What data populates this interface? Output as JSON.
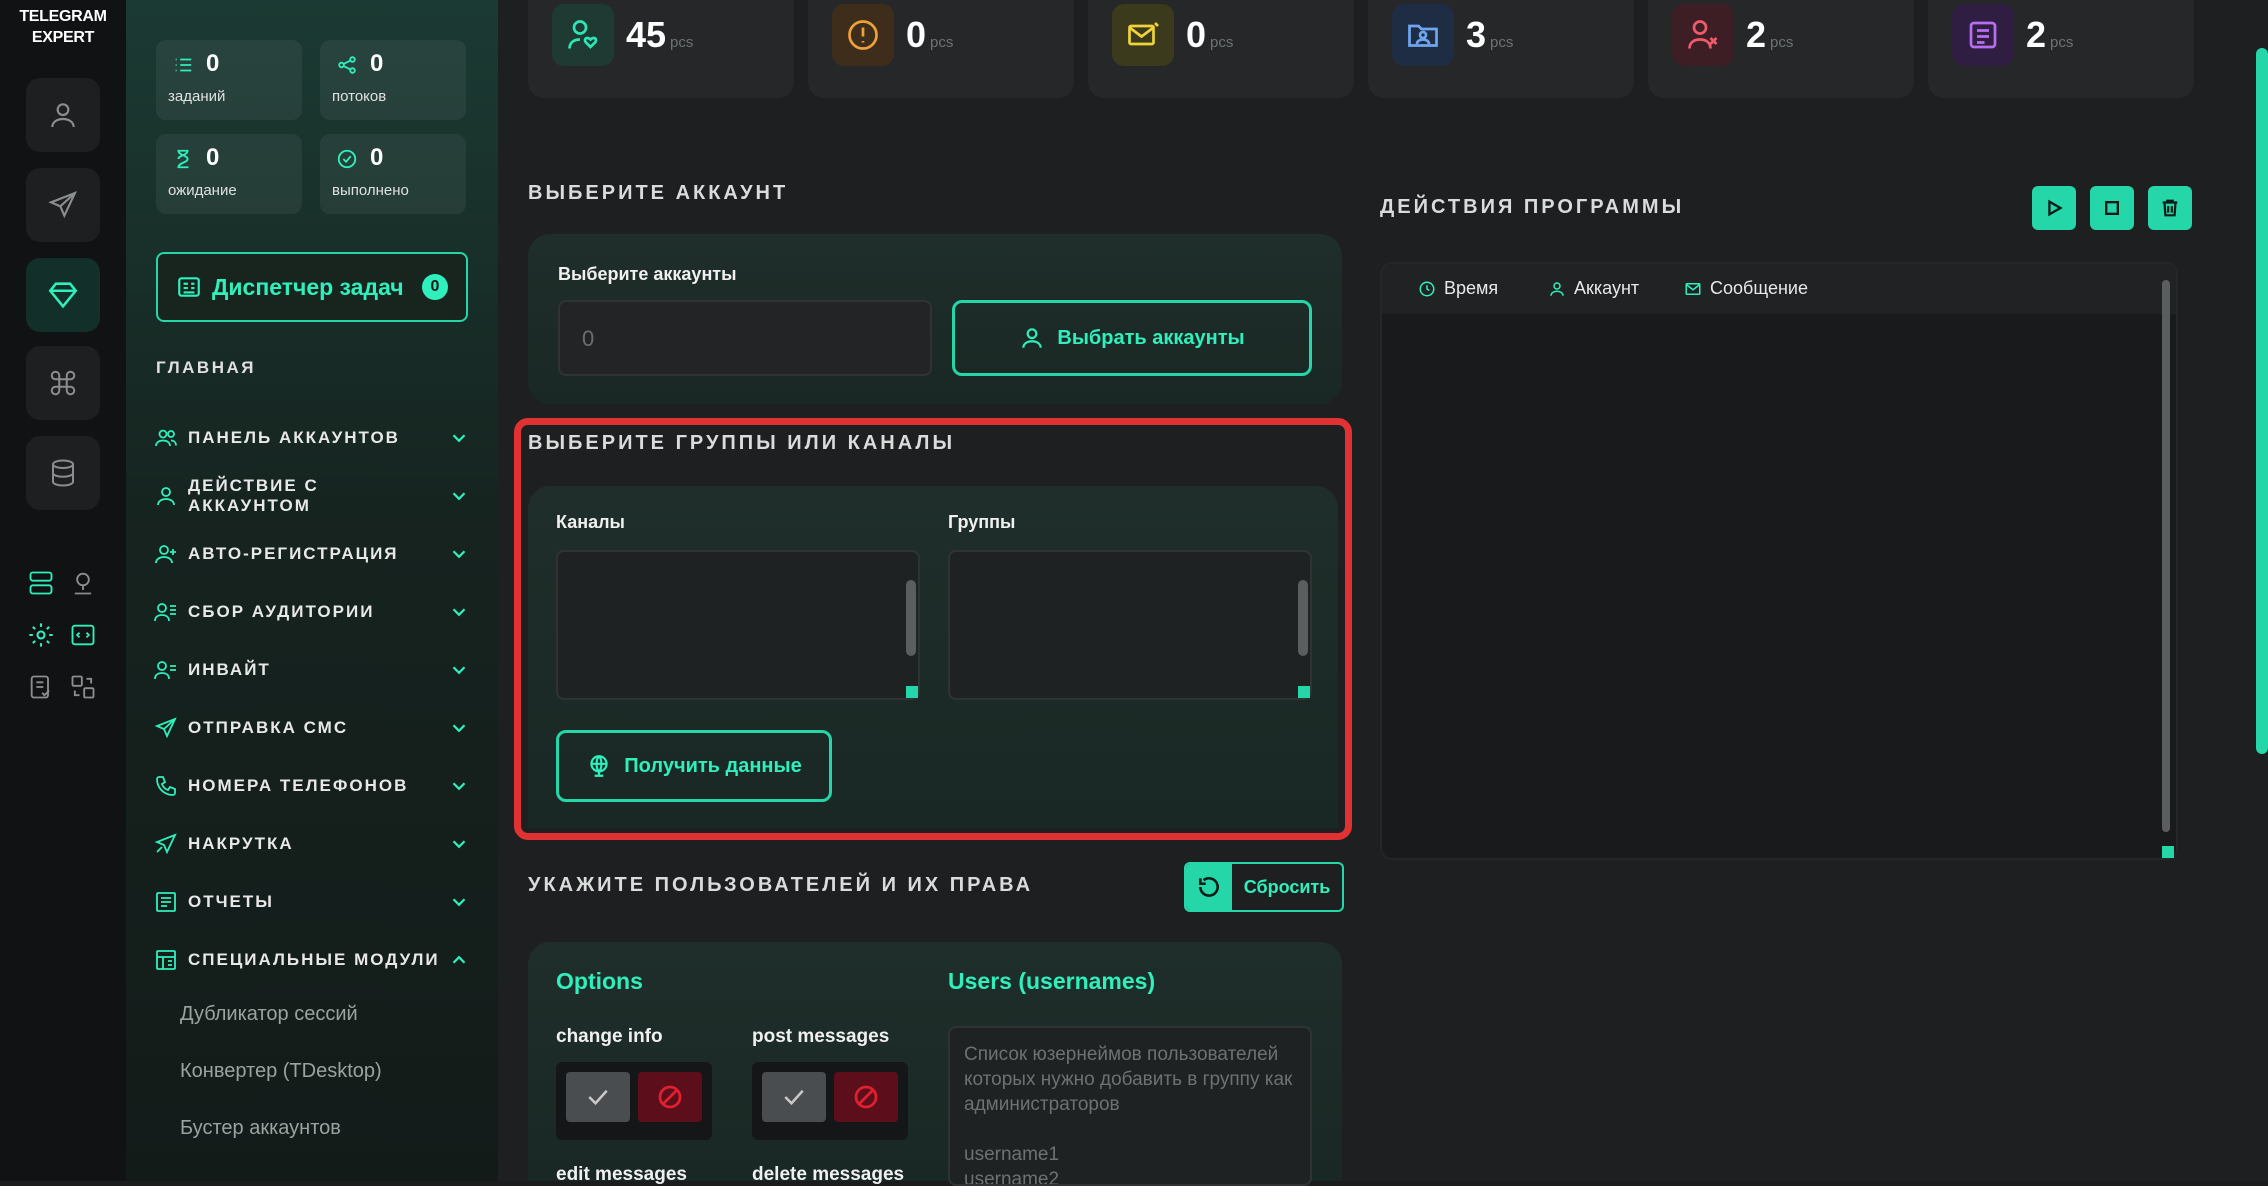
{
  "brand": {
    "line1": "TELEGRAM",
    "line2": "EXPERT"
  },
  "rail": {
    "buttons": [
      "user-icon",
      "send-icon",
      "diamond-icon",
      "command-icon",
      "database-icon"
    ],
    "mini_icons": [
      "server-icon",
      "map-pin-icon",
      "settings-icon",
      "code-window-icon",
      "checklist-icon",
      "transfer-icon"
    ]
  },
  "stats": [
    {
      "value": "0",
      "label": "заданий",
      "icon": "list-icon"
    },
    {
      "value": "0",
      "label": "потоков",
      "icon": "share-icon"
    },
    {
      "value": "0",
      "label": "ожидание",
      "icon": "hourglass-icon"
    },
    {
      "value": "0",
      "label": "выполнено",
      "icon": "check-circle-icon"
    }
  ],
  "task_manager": {
    "label": "Диспетчер задач",
    "count": "0"
  },
  "nav": {
    "heading": "ГЛАВНАЯ",
    "items": [
      {
        "label": "ПАНЕЛЬ АККАУНТОВ",
        "icon": "users-icon"
      },
      {
        "label": "ДЕЙСТВИЕ С АККАУНТОМ",
        "icon": "user-icon"
      },
      {
        "label": "АВТО-РЕГИСТРАЦИЯ",
        "icon": "user-plus-icon"
      },
      {
        "label": "СБОР АУДИТОРИИ",
        "icon": "user-list-icon"
      },
      {
        "label": "ИНВАЙТ",
        "icon": "user-invite-icon"
      },
      {
        "label": "ОТПРАВКА СМС",
        "icon": "send-icon"
      },
      {
        "label": "НОМЕРА ТЕЛЕФОНОВ",
        "icon": "phone-icon"
      },
      {
        "label": "НАКРУТКА",
        "icon": "boost-icon"
      },
      {
        "label": "ОТЧЕТЫ",
        "icon": "report-icon"
      },
      {
        "label": "СПЕЦИАЛЬНЫЕ МОДУЛИ",
        "icon": "modules-icon"
      }
    ],
    "sub_items": [
      "Дубликатор сессий",
      "Конвертер (TDesktop)",
      "Бустер аккаунтов"
    ]
  },
  "top_cards": [
    {
      "value": "45",
      "unit": "pcs",
      "icon": "user-heart-icon",
      "color": "#2ee6b5",
      "bg": "#1e3a33"
    },
    {
      "value": "0",
      "unit": "pcs",
      "icon": "alert-icon",
      "color": "#f0a03a",
      "bg": "#3d2d1a"
    },
    {
      "value": "0",
      "unit": "pcs",
      "icon": "mail-icon",
      "color": "#f0d23a",
      "bg": "#3b3a1c"
    },
    {
      "value": "3",
      "unit": "pcs",
      "icon": "folder-user-icon",
      "color": "#6fa6f0",
      "bg": "#1e2d44"
    },
    {
      "value": "2",
      "unit": "pcs",
      "icon": "user-x-icon",
      "color": "#f05a6a",
      "bg": "#3d1e24"
    },
    {
      "value": "2",
      "unit": "pcs",
      "icon": "stack-icon",
      "color": "#b56ff0",
      "bg": "#2f1e42"
    }
  ],
  "account": {
    "title": "ВЫБЕРИТЕ АККАУНТ",
    "field_label": "Выберите аккаунты",
    "value": "0",
    "button": "Выбрать аккаунты"
  },
  "groups": {
    "title": "ВЫБЕРИТЕ ГРУППЫ ИЛИ КАНАЛЫ",
    "channels_label": "Каналы",
    "groups_label": "Группы",
    "button": "Получить данные",
    "highlight_color": "#e03232"
  },
  "users": {
    "title": "УКАЖИТЕ ПОЛЬЗОВАТЕЛЕЙ И ИХ ПРАВА",
    "reset": "Сбросить",
    "options_title": "Options",
    "users_title": "Users (usernames)",
    "options": [
      "change info",
      "post messages",
      "edit messages",
      "delete messages"
    ],
    "placeholder": "Список юзернеймов пользователей которых нужно добавить в группу как администраторов\n\nusername1\nusername2"
  },
  "actions": {
    "title": "ДЕЙСТВИЯ ПРОГРАММЫ",
    "columns": [
      "Время",
      "Аккаунт",
      "Сообщение"
    ]
  },
  "colors": {
    "accent": "#24d6a8",
    "accent_text": "#2ff0bc"
  }
}
